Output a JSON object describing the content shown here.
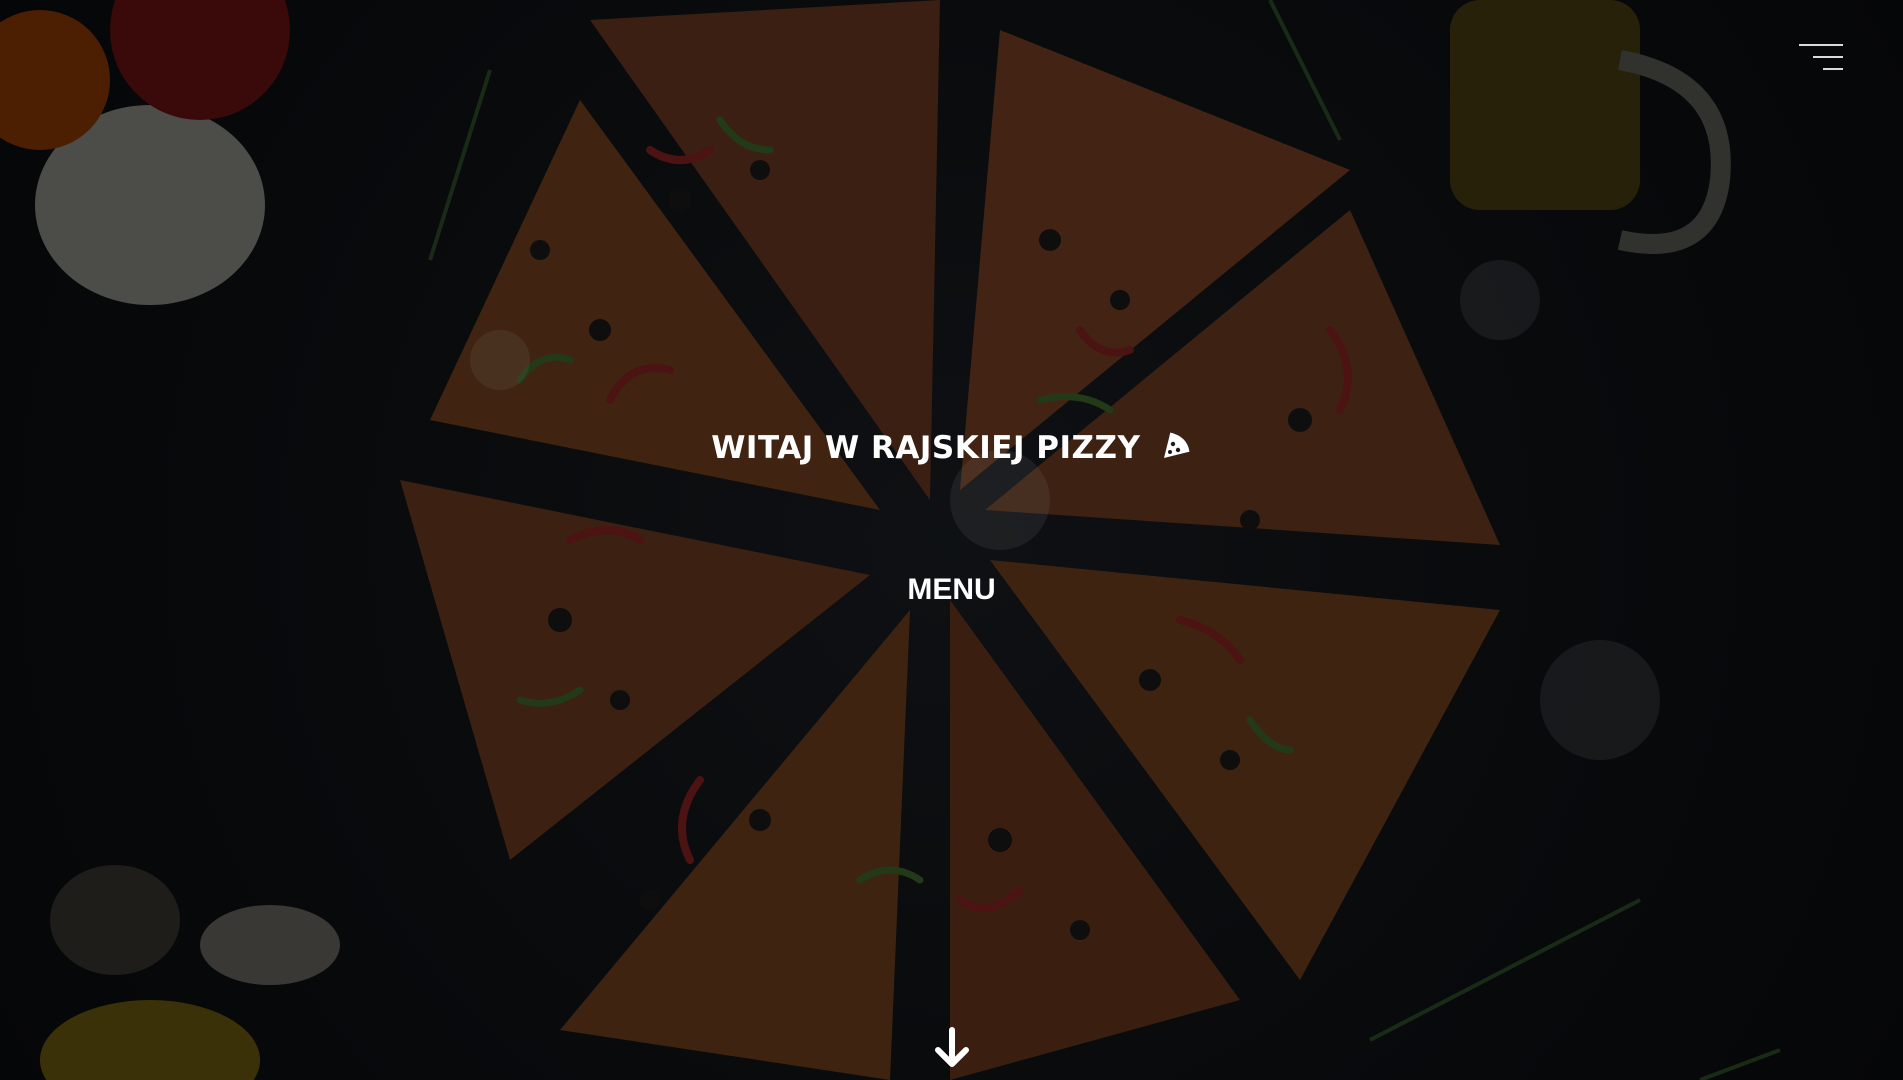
{
  "hero": {
    "headline": "WITAJ W RAJSKIEJ PIZZY",
    "headline_icon": "pizza-slice-icon",
    "menu_label": "MENU",
    "scroll_icon": "arrow-down-icon"
  },
  "nav": {
    "toggle_icon": "hamburger-menu-icon"
  },
  "colors": {
    "text": "#ffffff",
    "background": "#0d0f12"
  }
}
